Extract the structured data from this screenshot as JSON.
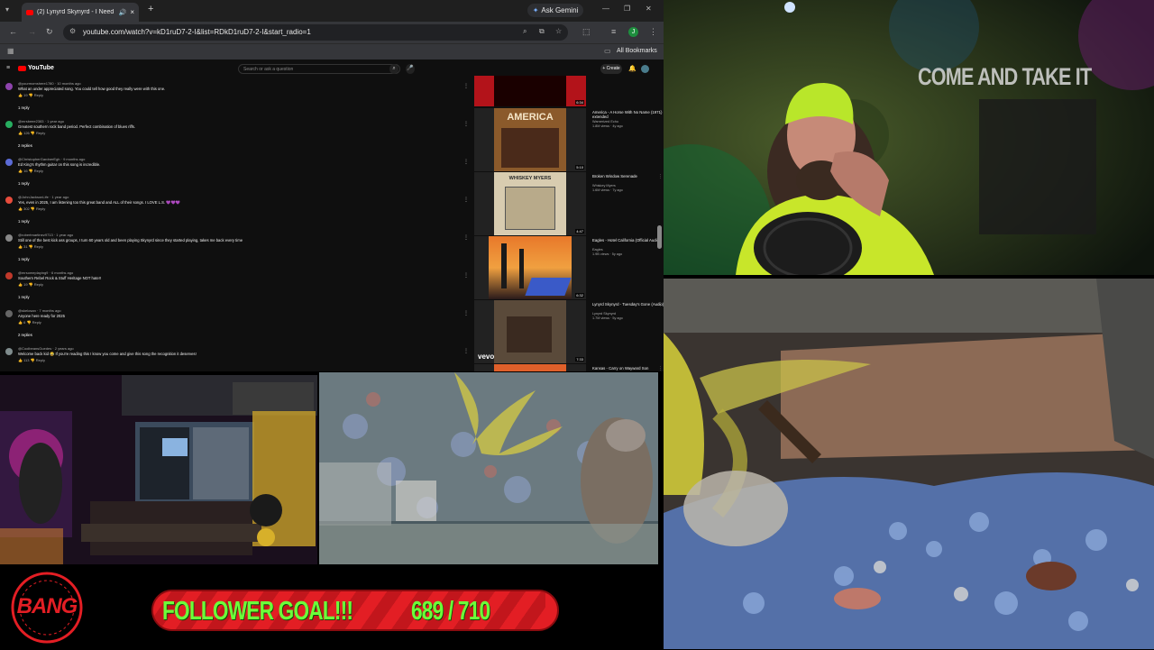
{
  "browser": {
    "tab_title": "(2) Lynyrd Skynyrd - I Need",
    "new_tab": "+",
    "ask_gemini": "Ask Gemini",
    "url": "youtube.com/watch?v=kD1ruD7-2-I&list=RDkD1ruD7-2-I&start_radio=1",
    "all_bookmarks": "All Bookmarks",
    "profile_initial": "J"
  },
  "youtube": {
    "logo": "YouTube",
    "search_placeholder": "Search or ask a question",
    "create": "+ Create",
    "comments": [
      {
        "user": "@yourmomshere1780 · 10 months ago",
        "text": "What an under appreciated song. You could tell how good they really were with this one.",
        "likes": "19",
        "reply_label": "Reply",
        "replies": "1 reply",
        "color": "#8e44ad"
      },
      {
        "user": "@mrsbeee2383 · 1 year ago",
        "text": "Greatest southern rock band period. Perfect combination of blues riffs.",
        "likes": "126",
        "reply_label": "Reply",
        "replies": "2 replies",
        "color": "#27ae60"
      },
      {
        "user": "@ChristopherGardnerEgh · 9 months ago",
        "text": "Ed King's rhythm guitar on this song is incredible.",
        "likes": "16",
        "reply_label": "Reply",
        "replies": "1 reply",
        "color": "#5b6bd6"
      },
      {
        "user": "@JohnJacksonLife · 1 year ago",
        "text": "Yes, even in 2025, I am listening too this great band and ALL of their songs. I LOVE L.S. 💜💜💜",
        "likes": "302",
        "reply_label": "Reply",
        "replies": "1 reply",
        "color": "#e74c3c"
      },
      {
        "user": "@robertmartinez9713 · 1 year ago",
        "text": "Still one of the best kick ass groups, I turn 60 years old and been playing Skynyrd since they started playing, takes me back every time",
        "likes": "31",
        "reply_label": "Reply",
        "replies": "1 reply",
        "color": "#888888"
      },
      {
        "user": "@mrsomeplaying9 · 6 months ago",
        "text": "Southern Rebel Rock & Stuff Heritage NOT hate!!",
        "likes": "19",
        "reply_label": "Reply",
        "replies": "1 reply",
        "color": "#c0392b"
      },
      {
        "user": "@skelosan · 7 months ago",
        "text": "Anyone here ready for 2025",
        "likes": "6",
        "reply_label": "Reply",
        "replies": "2 replies",
        "color": "#666666"
      },
      {
        "user": "@CoolbeansGuedes · 2 years ago",
        "text": "Welcome back kid 😂 If you're reading this I know you come and give this song the recognition it deserves!",
        "likes": "113",
        "reply_label": "Reply",
        "replies": "",
        "color": "#7f8c8d"
      }
    ],
    "videos": [
      {
        "title": "",
        "channel": "",
        "meta": "",
        "duration": "6:34",
        "thumb": "red"
      },
      {
        "title": "America - A Horse With No Name (1971) extended",
        "channel": "Warnerized Echo",
        "meta": "1.8M views · 4y ago",
        "duration": "5:10",
        "thumb": "america",
        "thumb_text": "AMERICA"
      },
      {
        "title": "Broken Window Serenade",
        "channel": "Whiskey Myers",
        "meta": "1.6M views · 7y ago",
        "duration": "4:47",
        "thumb": "whiskey",
        "thumb_text": "WHISKEY MYERS"
      },
      {
        "title": "Eagles - Hotel California (Official Audio)",
        "channel": "Eagles",
        "meta": "1.9B views · 5y ago",
        "duration": "6:32",
        "thumb": "hotel"
      },
      {
        "title": "Lynyrd Skynyrd - Tuesday's Gone (Audio)",
        "channel": "Lynyrd Skynyrd",
        "meta": "1.7M views · 5y ago",
        "duration": "7:33",
        "thumb": "skynyrd",
        "thumb_text": "vevo"
      },
      {
        "title": "Kansas - Carry on Wayward Son",
        "channel": "",
        "meta": "",
        "duration": "",
        "thumb": "orange"
      }
    ]
  },
  "overlay": {
    "cam_banner": "COME AND TAKE IT",
    "badge_text": "BANG",
    "goal_label": "FOLLOWER GOAL!!!",
    "goal_count": "689 / 710",
    "goal_current": 689,
    "goal_target": 710,
    "goal_color": "#6cff3a",
    "bar_color": "#e31e24"
  }
}
